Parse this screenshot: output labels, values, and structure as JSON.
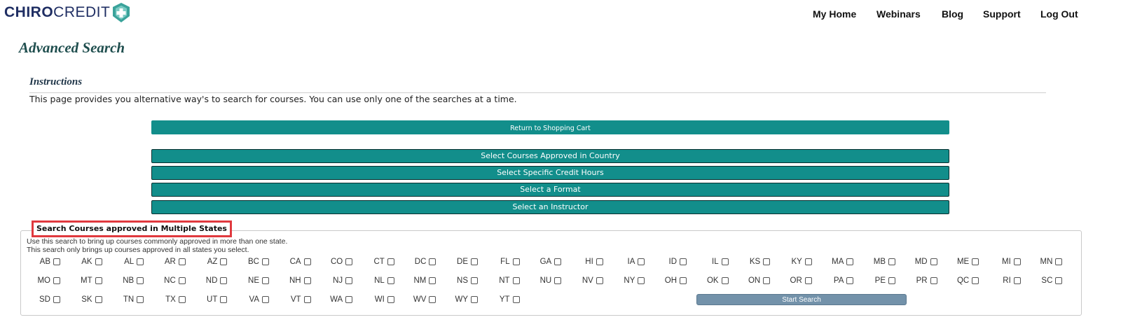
{
  "brand": {
    "name_bold": "CHIRO",
    "name_light": "CREDIT",
    "primary_color": "#1f2e63",
    "accent_color": "#3aa39b"
  },
  "nav": {
    "items": [
      "My Home",
      "Webinars",
      "Blog",
      "Support",
      "Log Out"
    ]
  },
  "page": {
    "title": "Advanced Search",
    "instructions_title": "Instructions",
    "instructions_text": "This page provides you alternative way's to search for courses. You can use only one of the searches at a time."
  },
  "buttons": {
    "return_label": "Return to Shopping Cart",
    "options": [
      "Select Courses Approved in Country",
      "Select Specific Credit Hours",
      "Select a Format",
      "Select an Instructor"
    ],
    "color": "#128e8b"
  },
  "multi_state": {
    "legend": "Search Courses approved in Multiple States",
    "desc_line1": "Use this search to bring up courses commonly approved in more than one state.",
    "desc_line2": "This search only brings up courses approved in all states you select.",
    "states": [
      "AB",
      "AK",
      "AL",
      "AR",
      "AZ",
      "BC",
      "CA",
      "CO",
      "CT",
      "DC",
      "DE",
      "FL",
      "GA",
      "HI",
      "IA",
      "ID",
      "IL",
      "KS",
      "KY",
      "MA",
      "MB",
      "MD",
      "ME",
      "MI",
      "MN",
      "MO",
      "MT",
      "NB",
      "NC",
      "ND",
      "NE",
      "NH",
      "NJ",
      "NL",
      "NM",
      "NS",
      "NT",
      "NU",
      "NV",
      "NY",
      "OH",
      "OK",
      "ON",
      "OR",
      "PA",
      "PE",
      "PR",
      "QC",
      "RI",
      "SC",
      "SD",
      "SK",
      "TN",
      "TX",
      "UT",
      "VA",
      "VT",
      "WA",
      "WI",
      "WV",
      "WY",
      "YT"
    ],
    "start_label": "Start Search",
    "highlight_color": "#e0393e"
  }
}
